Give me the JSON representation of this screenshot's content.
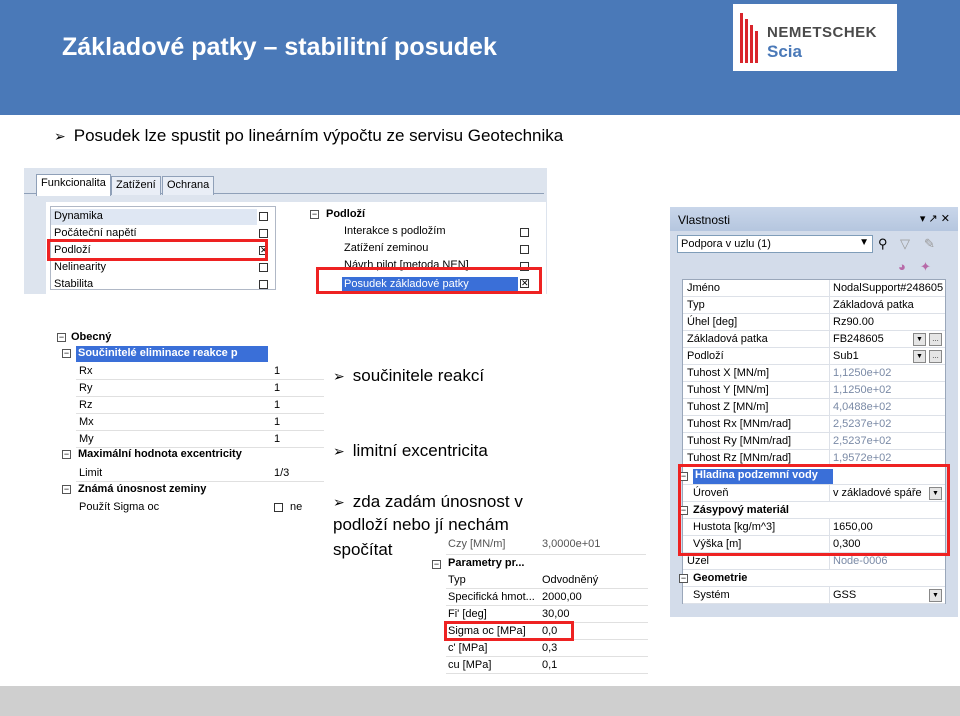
{
  "slide": {
    "title": "Základové patky – stabilitní posudek",
    "logo": {
      "brand": "NEMETSCHEK",
      "sub": "Scia"
    },
    "bullets": {
      "main": "Posudek lze spustit po lineárním výpočtu ze servisu Geotechnika",
      "b1": "součinitele reakcí",
      "b2": "limitní excentricita",
      "b3_line1": "zda zadám únosnost v",
      "b3_line2": "podloží nebo jí nechám",
      "b3_line3": "spočítat"
    }
  },
  "tabs_panel": {
    "tabs": [
      "Funkcionalita",
      "Zatížení",
      "Ochrana"
    ],
    "left_list": [
      {
        "label": "Dynamika",
        "checked": false
      },
      {
        "label": "Počáteční napětí",
        "checked": false
      },
      {
        "label": "Podloží",
        "checked": true
      },
      {
        "label": "Nelinearity",
        "checked": false
      },
      {
        "label": "Stabilita",
        "checked": false
      }
    ],
    "right_group": "Podloží",
    "right_list": [
      {
        "label": "Interakce s podložím",
        "checked": false
      },
      {
        "label": "Zatížení zeminou",
        "checked": false
      },
      {
        "label": "Návrh pilot [metoda NEN]",
        "checked": false
      },
      {
        "label": "Posudek základové patky",
        "checked": true
      }
    ]
  },
  "coef_panel": {
    "root": "Obecný",
    "group1": "Součinitelé eliminace reakce p",
    "rows": [
      {
        "k": "Rx",
        "v": "1"
      },
      {
        "k": "Ry",
        "v": "1"
      },
      {
        "k": "Rz",
        "v": "1"
      },
      {
        "k": "Mx",
        "v": "1"
      },
      {
        "k": "My",
        "v": "1"
      }
    ],
    "group2": "Maximální hodnota excentricity",
    "limit": {
      "k": "Limit",
      "v": "1/3"
    },
    "group3": "Známá únosnost zeminy",
    "sigma": {
      "k": "Použít Sigma oc",
      "v": "ne"
    }
  },
  "soil_panel": {
    "top_row": {
      "k": "Czy [MN/m]",
      "v": "3,0000e+01"
    },
    "group": "Parametry pr...",
    "rows": [
      {
        "k": "Typ",
        "v": "Odvodněný"
      },
      {
        "k": "Specifická hmot...",
        "v": "2000,00"
      },
      {
        "k": "Fi' [deg]",
        "v": "30,00"
      },
      {
        "k": "Sigma oc [MPa]",
        "v": "0,0"
      },
      {
        "k": "c' [MPa]",
        "v": "0,3"
      },
      {
        "k": "cu [MPa]",
        "v": "0,1"
      }
    ]
  },
  "properties": {
    "title": "Vlastnosti",
    "pin": "▾ ↗ ✕",
    "selector": "Podpora v uzlu (1)",
    "rows": [
      {
        "k": "Jméno",
        "v": "NodalSupport#248605"
      },
      {
        "k": "Typ",
        "v": "Základová patka"
      },
      {
        "k": "Úhel [deg]",
        "v": "Rz90.00"
      },
      {
        "k": "Základová patka",
        "v": "FB248605"
      },
      {
        "k": "Podloží",
        "v": "Sub1"
      },
      {
        "k": "Tuhost X [MN/m]",
        "v": "1,1250e+02"
      },
      {
        "k": "Tuhost Y [MN/m]",
        "v": "1,1250e+02"
      },
      {
        "k": "Tuhost Z [MN/m]",
        "v": "4,0488e+02"
      },
      {
        "k": "Tuhost Rx [MNm/rad]",
        "v": "2,5237e+02"
      },
      {
        "k": "Tuhost Ry [MNm/rad]",
        "v": "2,5237e+02"
      },
      {
        "k": "Tuhost Rz [MNm/rad]",
        "v": "1,9572e+02"
      }
    ],
    "group_water": "Hladina podzemní vody",
    "water_level": {
      "k": "Úroveň",
      "v": "v základové spáře"
    },
    "group_fill": "Zásypový materiál",
    "density": {
      "k": "Hustota [kg/m^3]",
      "v": "1650,00"
    },
    "height": {
      "k": "Výška [m]",
      "v": "0,300"
    },
    "node": {
      "k": "Uzel",
      "v": "Node-0006"
    },
    "group_geom": "Geometrie",
    "system": {
      "k": "Systém",
      "v": "GSS"
    }
  },
  "colors": {
    "header": "#4a79b8",
    "highlight": "#e22222",
    "selection": "#3a6fd8"
  }
}
